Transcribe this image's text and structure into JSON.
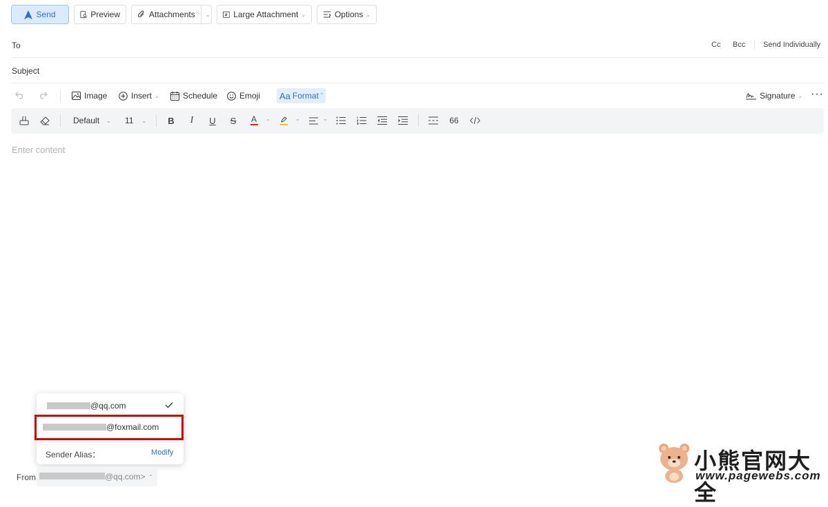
{
  "actions": {
    "send_label": "Send",
    "preview_label": "Preview",
    "attachments_label": "Attachments",
    "large_attachment_label": "Large Attachment",
    "options_label": "Options"
  },
  "recipients": {
    "to_label": "To",
    "cc_label": "Cc",
    "bcc_label": "Bcc",
    "send_individually_label": "Send Individually",
    "subject_label": "Subject"
  },
  "toolbar": {
    "image_label": "Image",
    "insert_label": "Insert",
    "schedule_label": "Schedule",
    "emoji_label": "Emoji",
    "format_label": "Format",
    "signature_label": "Signature"
  },
  "format": {
    "font_family": "Default",
    "font_size": "11",
    "quote_label": "66"
  },
  "editor": {
    "placeholder": "Enter content"
  },
  "from_menu": {
    "accounts": [
      {
        "suffix": "@qq.com",
        "selected": true
      },
      {
        "suffix": "@foxmail.com",
        "selected": false
      }
    ],
    "sender_alias_label": "Sender Alias：",
    "modify_label": "Modify"
  },
  "footer": {
    "from_label": "From:",
    "from_suffix": "@qq.com>"
  },
  "watermark": {
    "cn_text": "小熊官网大全",
    "url_text": "www.pagewebs.com"
  },
  "colors": {
    "accent": "#2e6fd6",
    "send_bg": "#dceaff",
    "highlight_box": "#e00000",
    "font_color_bar": "#e02020",
    "highlight_color_bar": "#f5c400"
  }
}
